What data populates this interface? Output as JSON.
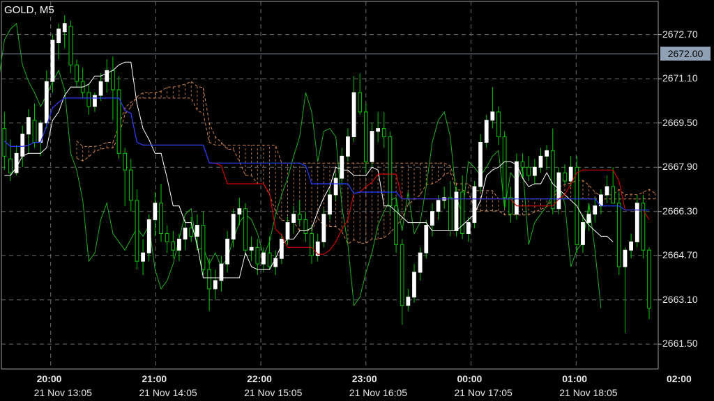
{
  "chart_data": {
    "type": "candlestick",
    "title": "GOLD, M5",
    "y_ticks": [
      "2672.70",
      "2671.10",
      "2669.50",
      "2667.90",
      "2666.30",
      "2664.70",
      "2663.10",
      "2661.50"
    ],
    "current_price": "2672.00",
    "x_time_labels": [
      "20:00",
      "21:00",
      "22:00",
      "23:00",
      "00:00",
      "01:00",
      "02:00"
    ],
    "x_date_labels": [
      "21 Nov 13:05",
      "21 Nov 14:05",
      "21 Nov 15:05",
      "21 Nov 16:05",
      "21 Nov 17:05",
      "21 Nov 18:05"
    ],
    "ylim": [
      2660.6,
      2673.9
    ],
    "candles": [
      [
        2669.3,
        2669.9,
        2667.8,
        2668.3
      ],
      [
        2668.2,
        2668.9,
        2667.4,
        2667.7
      ],
      [
        2667.7,
        2668.7,
        2667.6,
        2668.4
      ],
      [
        2668.3,
        2669.4,
        2667.9,
        2669.1
      ],
      [
        2669.1,
        2670.0,
        2668.4,
        2669.7
      ],
      [
        2669.6,
        2670.2,
        2668.6,
        2668.8
      ],
      [
        2668.8,
        2669.6,
        2668.3,
        2669.5
      ],
      [
        2669.5,
        2671.4,
        2669.3,
        2671.0
      ],
      [
        2671.0,
        2672.7,
        2670.6,
        2672.5
      ],
      [
        2672.4,
        2673.1,
        2671.8,
        2672.9
      ],
      [
        2672.8,
        2673.4,
        2672.2,
        2673.1
      ],
      [
        2673.0,
        2673.2,
        2671.3,
        2671.6
      ],
      [
        2671.6,
        2671.8,
        2670.8,
        2671.0
      ],
      [
        2671.0,
        2671.5,
        2670.4,
        2670.6
      ],
      [
        2670.6,
        2670.9,
        2669.8,
        2670.1
      ],
      [
        2670.1,
        2670.6,
        2669.9,
        2670.5
      ],
      [
        2670.5,
        2671.3,
        2670.3,
        2671.0
      ],
      [
        2671.0,
        2671.8,
        2670.6,
        2671.4
      ],
      [
        2671.4,
        2671.9,
        2669.6,
        2670.7
      ],
      [
        2670.7,
        2671.2,
        2668.2,
        2668.4
      ],
      [
        2668.4,
        2668.6,
        2666.5,
        2667.8
      ],
      [
        2667.8,
        2668.2,
        2666.3,
        2666.7
      ],
      [
        2666.7,
        2667.1,
        2664.2,
        2664.5
      ],
      [
        2664.5,
        2665.3,
        2664.0,
        2664.8
      ],
      [
        2664.8,
        2666.2,
        2664.5,
        2666.0
      ],
      [
        2666.0,
        2667.0,
        2665.4,
        2666.6
      ],
      [
        2666.6,
        2667.3,
        2665.2,
        2665.5
      ],
      [
        2665.5,
        2665.8,
        2664.8,
        2665.2
      ],
      [
        2665.2,
        2665.6,
        2664.6,
        2664.9
      ],
      [
        2664.9,
        2665.5,
        2664.5,
        2665.3
      ],
      [
        2665.3,
        2666.0,
        2664.9,
        2665.7
      ],
      [
        2665.7,
        2666.1,
        2665.2,
        2665.4
      ],
      [
        2665.4,
        2666.2,
        2665.1,
        2665.8
      ],
      [
        2665.8,
        2666.3,
        2664.0,
        2664.2
      ],
      [
        2664.2,
        2664.6,
        2662.7,
        2663.5
      ],
      [
        2663.5,
        2664.2,
        2663.1,
        2663.8
      ],
      [
        2663.8,
        2664.7,
        2663.4,
        2664.4
      ],
      [
        2664.4,
        2665.6,
        2664.1,
        2665.3
      ],
      [
        2665.3,
        2666.4,
        2665.0,
        2666.2
      ],
      [
        2666.2,
        2666.8,
        2665.8,
        2666.4
      ],
      [
        2666.4,
        2666.6,
        2664.7,
        2664.9
      ],
      [
        2664.9,
        2665.4,
        2664.5,
        2665.0
      ],
      [
        2665.0,
        2665.3,
        2664.0,
        2664.4
      ],
      [
        2664.4,
        2665.0,
        2664.1,
        2664.8
      ],
      [
        2664.8,
        2665.4,
        2664.2,
        2664.3
      ],
      [
        2664.3,
        2664.9,
        2664.0,
        2664.6
      ],
      [
        2664.6,
        2665.5,
        2664.4,
        2665.3
      ],
      [
        2665.3,
        2666.1,
        2665.1,
        2665.9
      ],
      [
        2665.9,
        2666.5,
        2665.5,
        2666.2
      ],
      [
        2666.2,
        2666.7,
        2665.8,
        2666.0
      ],
      [
        2666.0,
        2666.3,
        2665.2,
        2665.5
      ],
      [
        2665.5,
        2665.8,
        2664.4,
        2664.7
      ],
      [
        2664.7,
        2665.5,
        2664.5,
        2665.2
      ],
      [
        2665.2,
        2666.4,
        2665.0,
        2666.2
      ],
      [
        2666.2,
        2667.1,
        2666.0,
        2666.9
      ],
      [
        2666.9,
        2667.7,
        2666.7,
        2667.5
      ],
      [
        2667.5,
        2668.6,
        2667.3,
        2668.3
      ],
      [
        2668.3,
        2669.3,
        2668.1,
        2669.0
      ],
      [
        2669.0,
        2671.2,
        2668.8,
        2670.6
      ],
      [
        2670.6,
        2671.3,
        2669.8,
        2669.9
      ],
      [
        2669.9,
        2670.2,
        2667.7,
        2668.1
      ],
      [
        2668.1,
        2669.5,
        2667.9,
        2669.2
      ],
      [
        2669.2,
        2669.9,
        2668.8,
        2669.3
      ],
      [
        2669.3,
        2669.9,
        2668.6,
        2669.0
      ],
      [
        2669.0,
        2669.2,
        2666.2,
        2666.5
      ],
      [
        2666.5,
        2666.8,
        2664.8,
        2665.1
      ],
      [
        2665.1,
        2665.3,
        2662.2,
        2662.9
      ],
      [
        2662.9,
        2663.5,
        2662.7,
        2663.2
      ],
      [
        2663.2,
        2664.4,
        2663.0,
        2664.1
      ],
      [
        2664.1,
        2665.0,
        2663.8,
        2664.8
      ],
      [
        2664.8,
        2666.0,
        2664.6,
        2665.8
      ],
      [
        2665.8,
        2666.6,
        2665.4,
        2666.3
      ],
      [
        2666.3,
        2666.9,
        2666.0,
        2666.7
      ],
      [
        2666.7,
        2667.2,
        2666.4,
        2666.8
      ],
      [
        2666.8,
        2667.4,
        2665.4,
        2665.6
      ],
      [
        2665.6,
        2667.2,
        2665.4,
        2667.0
      ],
      [
        2667.0,
        2667.6,
        2665.3,
        2665.5
      ],
      [
        2665.5,
        2666.1,
        2665.2,
        2665.9
      ],
      [
        2665.9,
        2667.4,
        2665.7,
        2667.2
      ],
      [
        2667.2,
        2669.1,
        2667.0,
        2668.8
      ],
      [
        2668.8,
        2669.8,
        2668.6,
        2669.6
      ],
      [
        2669.6,
        2670.8,
        2669.3,
        2669.9
      ],
      [
        2669.9,
        2670.1,
        2668.7,
        2669.0
      ],
      [
        2669.0,
        2669.2,
        2666.5,
        2666.8
      ],
      [
        2666.8,
        2667.2,
        2665.9,
        2666.2
      ],
      [
        2666.2,
        2668.4,
        2666.0,
        2668.1
      ],
      [
        2668.1,
        2668.4,
        2667.5,
        2667.9
      ],
      [
        2667.9,
        2668.3,
        2667.4,
        2667.6
      ],
      [
        2667.6,
        2668.2,
        2667.3,
        2667.9
      ],
      [
        2667.9,
        2668.6,
        2667.7,
        2668.3
      ],
      [
        2668.3,
        2668.7,
        2667.8,
        2668.5
      ],
      [
        2668.5,
        2669.3,
        2666.2,
        2666.4
      ],
      [
        2666.4,
        2667.9,
        2666.2,
        2667.7
      ],
      [
        2667.7,
        2668.0,
        2667.3,
        2667.4
      ],
      [
        2667.4,
        2668.3,
        2667.2,
        2667.9
      ],
      [
        2667.9,
        2668.3,
        2664.8,
        2665.1
      ],
      [
        2665.1,
        2666.2,
        2664.8,
        2665.9
      ],
      [
        2665.9,
        2666.5,
        2665.6,
        2666.2
      ],
      [
        2666.2,
        2666.8,
        2665.9,
        2666.5
      ],
      [
        2666.5,
        2667.1,
        2666.2,
        2666.9
      ],
      [
        2666.9,
        2667.6,
        2666.6,
        2667.2
      ],
      [
        2667.2,
        2667.9,
        2666.9,
        2666.6
      ],
      [
        2666.6,
        2667.0,
        2664.0,
        2664.3
      ],
      [
        2664.3,
        2665.0,
        2661.9,
        2664.9
      ],
      [
        2664.9,
        2665.5,
        2664.6,
        2665.2
      ],
      [
        2665.2,
        2666.9,
        2665.0,
        2666.6
      ],
      [
        2666.6,
        2666.9,
        2664.6,
        2664.9
      ],
      [
        2664.9,
        2665.0,
        2662.4,
        2662.8
      ]
    ],
    "tenkan": [
      2667.6,
      2667.6,
      2667.9,
      2668.3,
      2668.4,
      2668.4,
      2668.4,
      2668.6,
      2669.6,
      2669.9,
      2670.5,
      2670.8,
      2670.8,
      2670.8,
      2670.9,
      2671.2,
      2671.2,
      2671.3,
      2671.4,
      2671.6,
      2671.7,
      2671.7,
      2670.2,
      2669.3,
      2668.9,
      2668.4,
      2668.4,
      2667.5,
      2666.5,
      2666.5,
      2665.9,
      2665.9,
      2665.1,
      2663.9,
      2663.9,
      2663.9,
      2663.9,
      2663.9,
      2663.9,
      2663.9,
      2664.8,
      2664.3,
      2664.2,
      2664.2,
      2664.2,
      2664.6,
      2665.1,
      2665.3,
      2665.3,
      2665.6,
      2665.6,
      2665.7,
      2666.3,
      2666.8,
      2667.2,
      2667.9,
      2667.8,
      2667.8,
      2667.6,
      2667.6,
      2667.6,
      2667.9,
      2667.8,
      2666.5,
      2666.5,
      2666.3,
      2666.1,
      2665.9,
      2665.9,
      2665.9,
      2665.9,
      2665.6,
      2665.6,
      2665.6,
      2665.6,
      2665.6,
      2665.8,
      2666.0,
      2666.2,
      2666.7,
      2667.6,
      2667.8,
      2667.9,
      2668.1,
      2668.1,
      2668.0,
      2667.5,
      2667.2,
      2667.3,
      2667.3,
      2667.7,
      2667.3,
      2667.1,
      2666.9,
      2666.7,
      2666.5,
      2666.1,
      2665.8,
      2665.6,
      2665.4,
      2665.4,
      2665.2
    ]
  },
  "colors": {
    "background": "#000000",
    "grid": "#6e6e6e",
    "bull": "#ffffff",
    "bear": "#00c800",
    "tenkan": "#ffffff",
    "kijun": "#d00000",
    "chikou": "#1faf1f",
    "blue_line": "#1f3fff",
    "cloud": "#e6915a",
    "price_line": "#8ea1b4"
  }
}
